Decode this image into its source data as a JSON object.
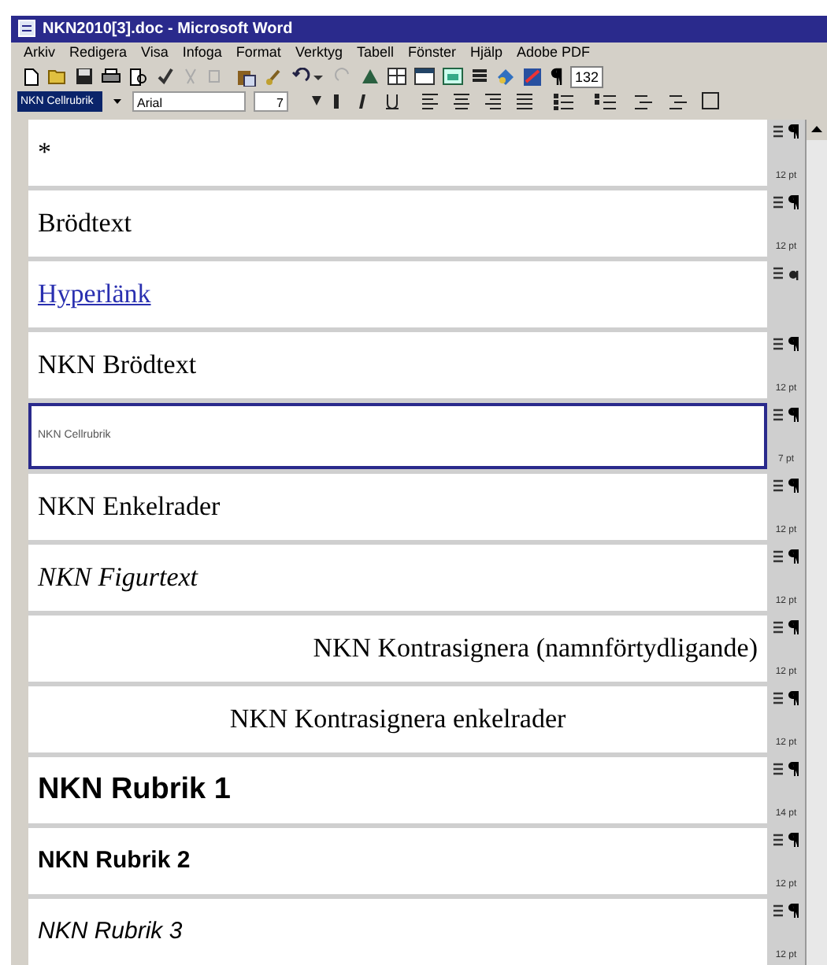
{
  "window": {
    "title": "NKN2010[3].doc - Microsoft Word"
  },
  "menu": [
    "Arkiv",
    "Redigera",
    "Visa",
    "Infoga",
    "Format",
    "Verktyg",
    "Tabell",
    "Fönster",
    "Hjälp",
    "Adobe PDF"
  ],
  "toolbar": {
    "zoom": "132"
  },
  "format_bar": {
    "style": "NKN Cellrubrik",
    "font": "Arial",
    "size": "7"
  },
  "styles": [
    {
      "label": "*",
      "kind": "plain",
      "character_style": false,
      "size": "12 pt",
      "selected": false
    },
    {
      "label": "Brödtext",
      "kind": "plain",
      "character_style": false,
      "size": "12 pt",
      "selected": false
    },
    {
      "label": "Hyperlänk",
      "kind": "link",
      "character_style": true,
      "selected": false
    },
    {
      "label": "NKN Brödtext",
      "kind": "plain",
      "character_style": false,
      "size": "12 pt",
      "selected": false
    },
    {
      "label": "NKN Cellrubrik",
      "kind": "small",
      "character_style": false,
      "size": "7 pt",
      "selected": true
    },
    {
      "label": "NKN Enkelrader",
      "kind": "plain",
      "character_style": false,
      "size": "12 pt",
      "selected": false
    },
    {
      "label": "NKN Figurtext",
      "kind": "italic",
      "character_style": false,
      "size": "12 pt",
      "selected": false
    },
    {
      "label": "NKN Kontrasignera (namnförtydligande)",
      "kind": "right",
      "character_style": false,
      "size": "12 pt",
      "selected": false
    },
    {
      "label": "NKN Kontrasignera enkelrader",
      "kind": "centered",
      "character_style": false,
      "size": "12 pt",
      "selected": false
    },
    {
      "label": "NKN Rubrik 1",
      "kind": "heading1",
      "character_style": false,
      "size": "14 pt",
      "selected": false
    },
    {
      "label": "NKN Rubrik 2",
      "kind": "heading2",
      "character_style": false,
      "size": "12 pt",
      "selected": false
    },
    {
      "label": "NKN Rubrik 3",
      "kind": "heading3",
      "character_style": false,
      "size": "12 pt",
      "selected": false
    }
  ]
}
